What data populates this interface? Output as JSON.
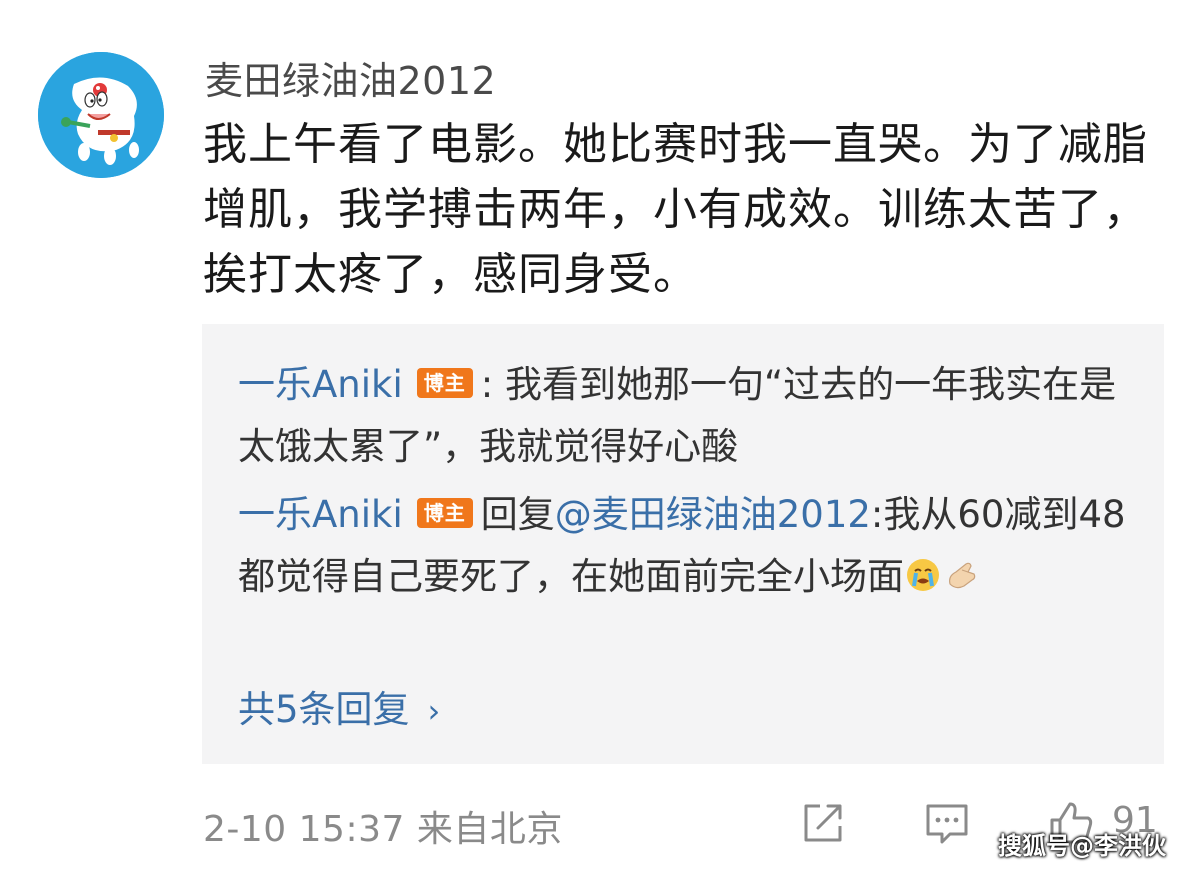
{
  "comment": {
    "avatar_icon": "doraemon-avatar-icon",
    "username": "麦田绿油油2012",
    "text": "我上午看了电影。她比赛时我一直哭。为了减脂增肌，我学搏击两年，小有成效。训练太苦了，挨打太疼了，感同身受。",
    "timestamp": "2-10 15:37",
    "location": "来自北京",
    "like_count": "91"
  },
  "replies": [
    {
      "name": "一乐Aniki",
      "badge": "博主",
      "separator": ":",
      "text": "我看到她那一句“过去的一年我实在是太饿太累了”，我就觉得好心酸"
    },
    {
      "name": "一乐Aniki",
      "badge": "博主",
      "prefix": "回复",
      "mention": "@麦田绿油油2012",
      "text": ":我从60减到48都觉得自己要死了，在她面前完全小场面",
      "emojis": [
        "crying-face-emoji",
        "pinched-fingers-emoji"
      ]
    }
  ],
  "more_replies": {
    "label": "共5条回复",
    "chevron": "›"
  },
  "actions": {
    "share_icon": "share-icon",
    "comment_icon": "comment-icon",
    "like_icon": "thumbs-up-icon"
  },
  "watermark": "搜狐号@李洪伙",
  "colors": {
    "link_blue": "#3a6fa8",
    "badge_orange": "#f0771b",
    "reply_bg": "#f4f4f5",
    "meta_gray": "#8a8a8a"
  }
}
